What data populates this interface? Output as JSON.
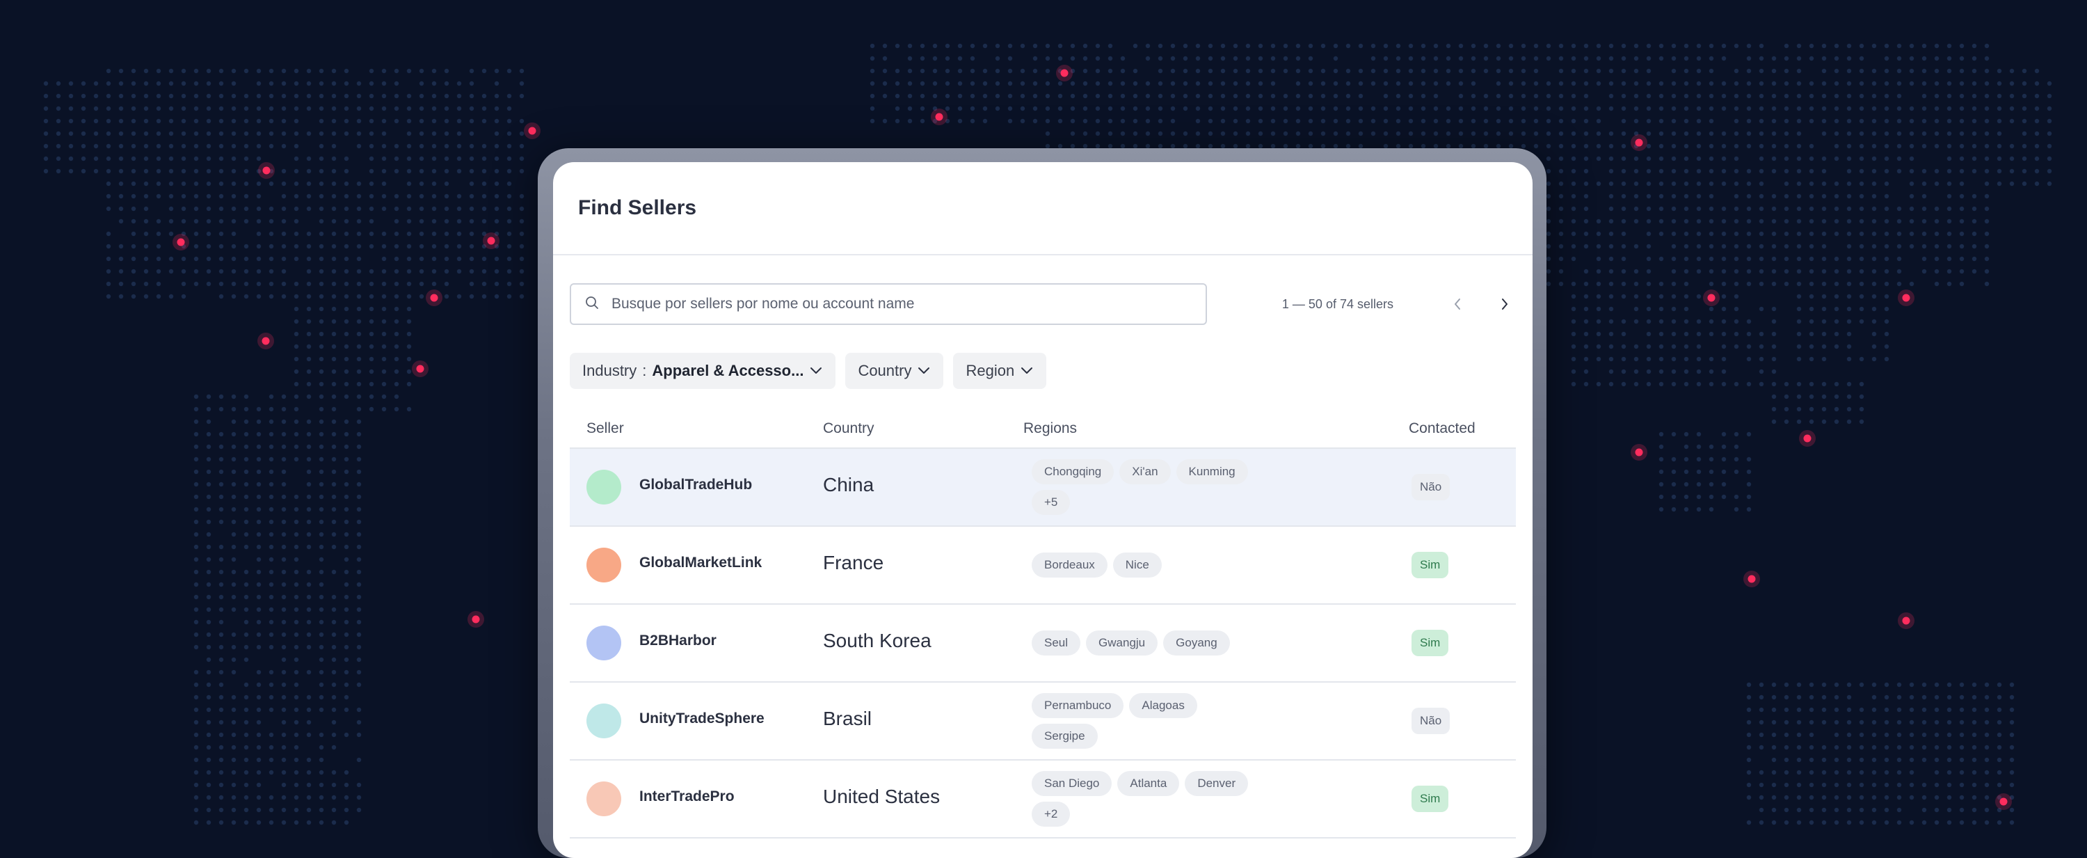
{
  "app": {
    "title": "Find Sellers"
  },
  "search": {
    "placeholder": "Busque por sellers por nome ou account name"
  },
  "pagination": {
    "text": "1 — 50 of 74 sellers"
  },
  "filters": [
    {
      "label": "Industry",
      "value": "Apparel & Accesso..."
    },
    {
      "label": "Country",
      "value": ""
    },
    {
      "label": "Region",
      "value": ""
    }
  ],
  "table": {
    "headers": {
      "seller": "Seller",
      "country": "Country",
      "regions": "Regions",
      "contacted": "Contacted"
    },
    "rows": [
      {
        "seller": "GlobalTradeHub",
        "country": "China",
        "regions": [
          "Chongqing",
          "Xi'an",
          "Kunming",
          "+5"
        ],
        "contacted": "Não",
        "contacted_status": "no",
        "avatar_color": "#b4ebcb",
        "selected": true
      },
      {
        "seller": "GlobalMarketLink",
        "country": "France",
        "regions": [
          "Bordeaux",
          "Nice"
        ],
        "contacted": "Sim",
        "contacted_status": "yes",
        "avatar_color": "#f8a886",
        "selected": false
      },
      {
        "seller": "B2BHarbor",
        "country": "South Korea",
        "regions": [
          "Seul",
          "Gwangju",
          "Goyang"
        ],
        "contacted": "Sim",
        "contacted_status": "yes",
        "avatar_color": "#b3c4f4",
        "selected": false
      },
      {
        "seller": "UnityTradeSphere",
        "country": "Brasil",
        "regions": [
          "Pernambuco",
          "Alagoas",
          "Sergipe"
        ],
        "contacted": "Não",
        "contacted_status": "no",
        "avatar_color": "#bfe8e8",
        "selected": false
      },
      {
        "seller": "InterTradePro",
        "country": "United States",
        "regions": [
          "San Diego",
          "Atlanta",
          "Denver",
          "+2"
        ],
        "contacted": "Sim",
        "contacted_status": "yes",
        "avatar_color": "#f8c8b6",
        "selected": false
      }
    ]
  },
  "colors": {
    "background": "#0a1226",
    "map_dot": "#1b2c4c",
    "map_highlight": "#ff2d5e",
    "badge_yes_bg": "#cdeed9",
    "badge_yes_text": "#2e7a4d",
    "selected_row": "#eef2fa"
  },
  "icons": {
    "search": "search-icon",
    "prev": "chevron-left-icon",
    "next": "chevron-right-icon",
    "dropdown": "chevron-down-icon"
  }
}
